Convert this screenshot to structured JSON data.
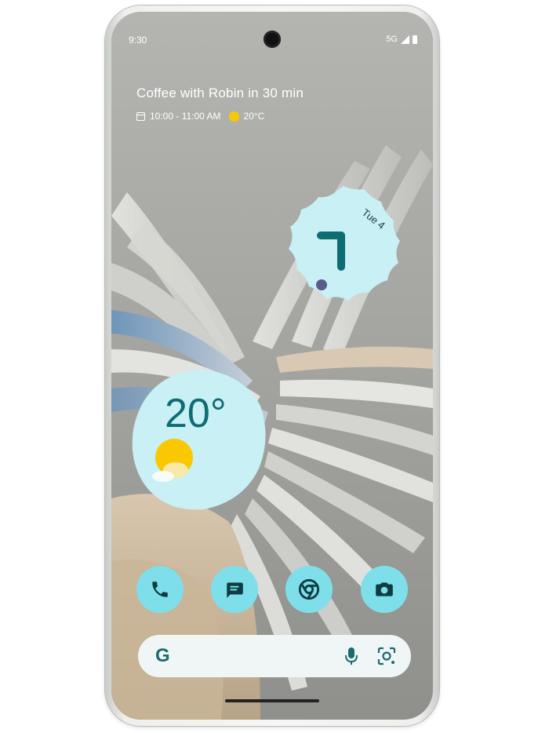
{
  "status_bar": {
    "time": "9:30",
    "network": "5G"
  },
  "at_a_glance": {
    "title": "Coffee with Robin in 30 min",
    "time_range": "10:00 - 11:00 AM",
    "temperature": "20°C"
  },
  "clock_widget": {
    "date": "Tue 4"
  },
  "weather_widget": {
    "temperature": "20°",
    "icon": "sun-icon"
  },
  "dock": {
    "apps": [
      {
        "name": "Phone",
        "icon": "phone-icon"
      },
      {
        "name": "Messages",
        "icon": "messages-icon"
      },
      {
        "name": "Chrome",
        "icon": "chrome-icon"
      },
      {
        "name": "Camera",
        "icon": "camera-icon"
      }
    ]
  },
  "search_bar": {
    "logo": "G",
    "icons": [
      "mic-icon",
      "lens-icon"
    ]
  },
  "colors": {
    "accent": "#7edfea",
    "widget_bg": "#c8f0f5",
    "widget_text": "#0e6c73"
  }
}
